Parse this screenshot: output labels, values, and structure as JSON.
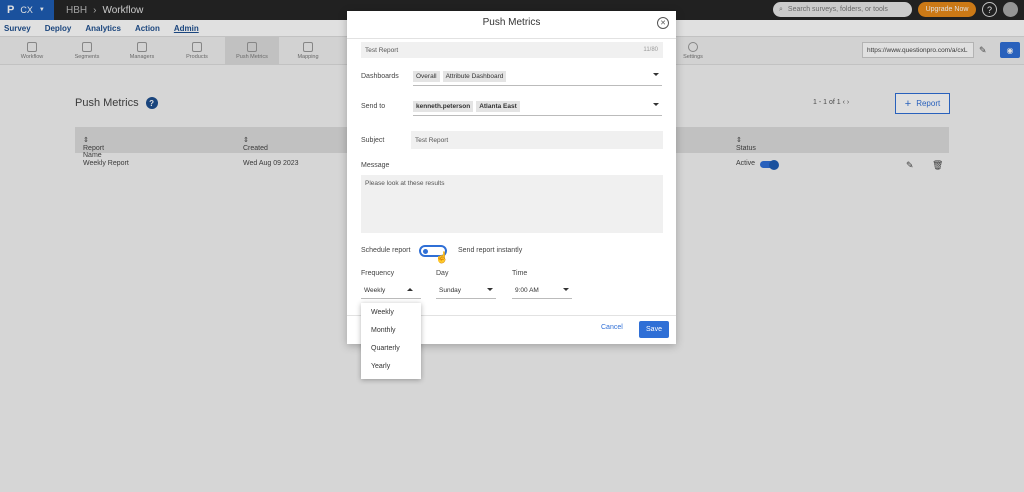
{
  "topbar": {
    "brand_logo": "P",
    "brand_product": "CX",
    "crumb_org": "HBH",
    "crumb_sep": "›",
    "crumb_page": "Workflow",
    "search_placeholder": "Search surveys, folders, or tools",
    "upgrade_label": "Upgrade Now",
    "help_label": "?"
  },
  "menubar": {
    "items": [
      "Survey",
      "Deploy",
      "Analytics",
      "Action",
      "Admin"
    ],
    "active": "Admin"
  },
  "subnav": {
    "items": [
      "Workflow",
      "Segments",
      "Managers",
      "Products",
      "Push Metrics",
      "Mapping",
      "Settings"
    ],
    "active": "Push Metrics",
    "url": "https://www.questionpro.com/a/cxL"
  },
  "page": {
    "title": "Push Metrics",
    "help_icon": "?",
    "pager": "1 - 1 of 1",
    "add_button": "Report",
    "columns": [
      "Report Name",
      "Created",
      "Status"
    ],
    "rows": [
      {
        "name": "Weekly Report",
        "created": "Wed Aug 09 2023",
        "status": "Active"
      }
    ]
  },
  "modal": {
    "title": "Push Metrics",
    "report_name_value": "Test Report",
    "report_name_count": "11/80",
    "dashboards_label": "Dashboards",
    "dashboards_chips": [
      "Overall",
      "Attribute Dashboard"
    ],
    "sendto_label": "Send to",
    "sendto_chips": [
      "kenneth.peterson",
      "Atlanta East"
    ],
    "subject_label": "Subject",
    "subject_value": "Test Report",
    "message_label": "Message",
    "message_value": "Please look at these results",
    "schedule_label": "Schedule report",
    "instant_label": "Send report instantly",
    "frequency_label": "Frequency",
    "frequency_value": "Weekly",
    "day_label": "Day",
    "day_value": "Sunday",
    "time_label": "Time",
    "time_value": "9:00 AM",
    "cancel_label": "Cancel",
    "save_label": "Save"
  },
  "frequency_options": [
    "Weekly",
    "Monthly",
    "Quarterly",
    "Yearly"
  ],
  "colors": {
    "accent": "#2f6fd6",
    "brand": "#1e5db3",
    "upgrade": "#e88a1a",
    "topbar": "#262626"
  }
}
